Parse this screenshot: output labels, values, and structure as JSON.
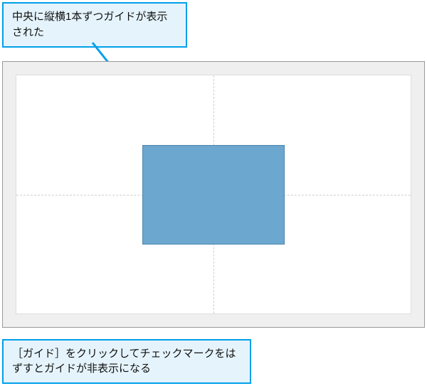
{
  "callouts": {
    "top": "中央に縦横1本ずつガイドが表示された",
    "bottom": "［ガイド］をクリックしてチェックマークをはずすとガイドが非表示になる"
  },
  "shape": {
    "name": "rectangle"
  },
  "accent_color": "#00a0e9"
}
